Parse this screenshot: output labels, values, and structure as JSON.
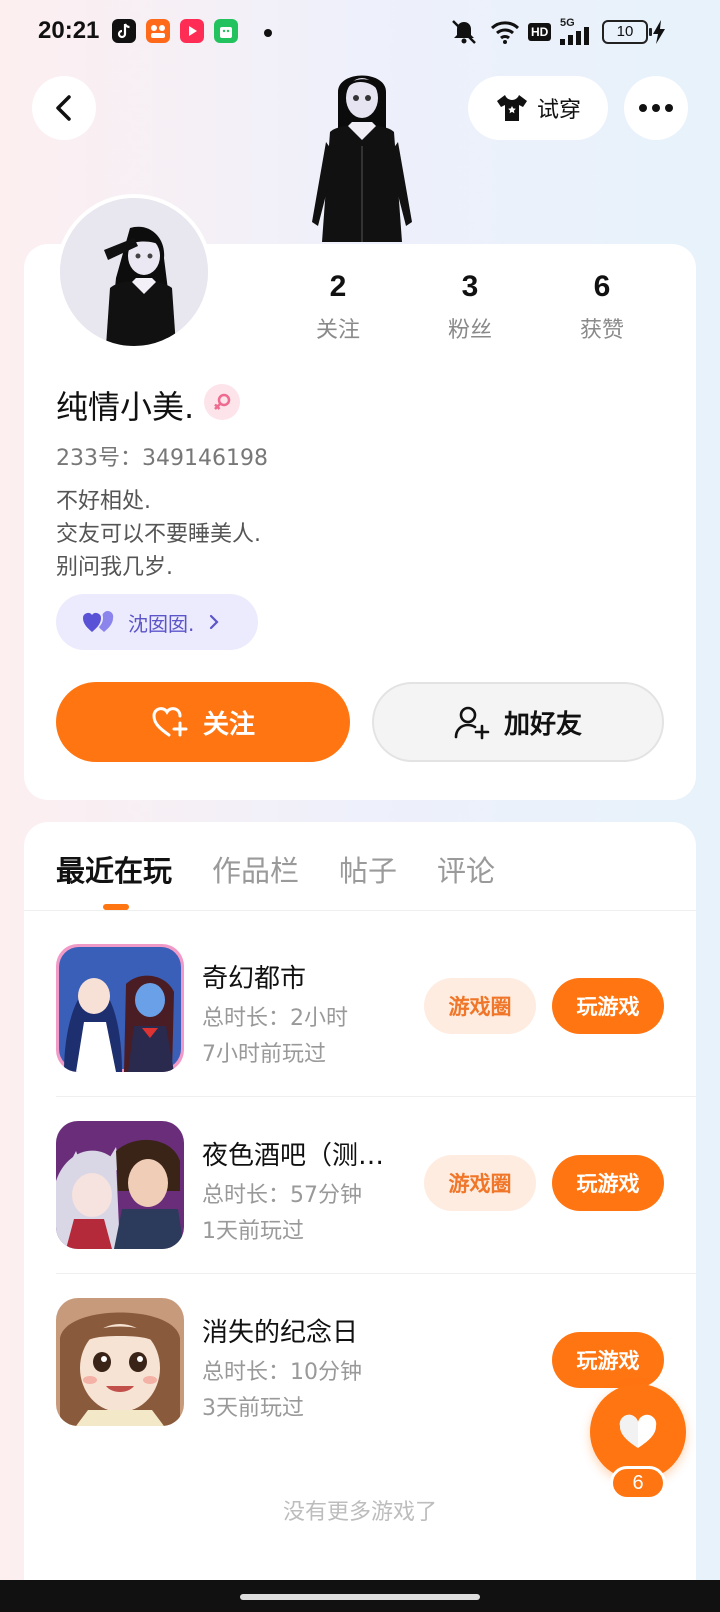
{
  "status_bar": {
    "time": "20:21",
    "battery": "10",
    "icons": [
      "tiktok-icon",
      "app-icon",
      "video-icon",
      "store-icon",
      "mute-icon",
      "wifi-icon",
      "hd-icon",
      "signal-5g-icon",
      "charging-icon"
    ],
    "hd_label": "HD",
    "network_label": "5G"
  },
  "header": {
    "try_on_label": "试穿"
  },
  "profile": {
    "stats": [
      {
        "num": "2",
        "label": "关注"
      },
      {
        "num": "3",
        "label": "粉丝"
      },
      {
        "num": "6",
        "label": "获赞"
      }
    ],
    "name": "纯情小美.",
    "uid": "233号：349146198",
    "bio": [
      "不好相处.",
      "交友可以不要睡美人.",
      "别问我几岁."
    ],
    "cp_name": "沈囡囡.",
    "follow_label": "关注",
    "add_friend_label": "加好友"
  },
  "tabs": [
    "最近在玩",
    "作品栏",
    "帖子",
    "评论"
  ],
  "games": [
    {
      "name": "奇幻都市",
      "duration": "总时长：2小时",
      "last_played": "7小时前玩过",
      "circle_label": "游戏圈",
      "play_label": "玩游戏"
    },
    {
      "name": "夜色酒吧（测…",
      "duration": "总时长：57分钟",
      "last_played": "1天前玩过",
      "circle_label": "游戏圈",
      "play_label": "玩游戏"
    },
    {
      "name": "消失的纪念日",
      "duration": "总时长：10分钟",
      "last_played": "3天前玩过",
      "play_label": "玩游戏"
    }
  ],
  "no_more_text": "没有更多游戏了",
  "like_fab": {
    "count": "6"
  },
  "colors": {
    "accent": "#ff7511",
    "circle_bg": "#feece0",
    "chip_bg": "#ecebfd"
  }
}
